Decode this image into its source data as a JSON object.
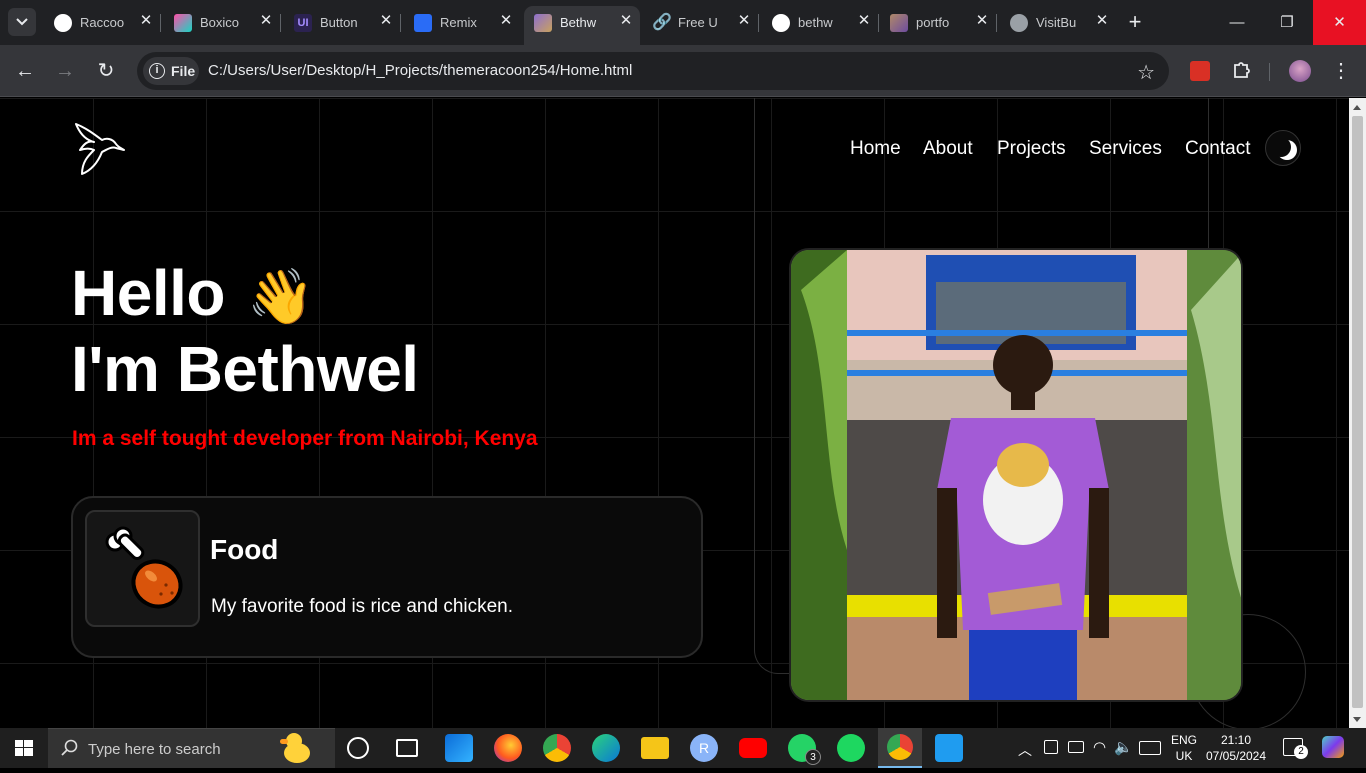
{
  "browser": {
    "tabs": [
      {
        "title": "Raccoo",
        "color": "#ffffff",
        "icon": "github-icon"
      },
      {
        "title": "Boxico",
        "color": "#16d6c3",
        "icon": "boxicons-icon"
      },
      {
        "title": "Button",
        "color": "#6c5ce7",
        "icon": "uiverse-icon"
      },
      {
        "title": "Remix",
        "color": "#2a6cf6",
        "icon": "remix-icon"
      },
      {
        "title": "Bethw",
        "color": "#8e6fd0",
        "icon": "site-icon",
        "active": true
      },
      {
        "title": "Free U",
        "color": "#8ab4f8",
        "icon": "link-icon"
      },
      {
        "title": "bethw",
        "color": "#ffffff",
        "icon": "github-icon"
      },
      {
        "title": "portfo",
        "color": "#b08968",
        "icon": "image-icon"
      },
      {
        "title": "VisitBu",
        "color": "#9aa0a6",
        "icon": "globe-icon"
      }
    ],
    "new_tab": "+",
    "address": {
      "scheme_label": "File",
      "url": "C:/Users/User/Desktop/H_Projects/themeracoon254/Home.html"
    }
  },
  "site": {
    "nav": [
      "Home",
      "About",
      "Projects",
      "Services",
      "Contact"
    ],
    "hero": {
      "greeting": "Hello",
      "wave_emoji": "👋",
      "name_line": "I'm Bethwel",
      "tagline": "Im a self tought developer from Nairobi, Kenya"
    },
    "card": {
      "title": "Food",
      "text": "My favorite food is rice and chicken."
    },
    "accent_color": "#ff0000"
  },
  "taskbar": {
    "search_placeholder": "Type here to search",
    "whatsapp_badge": "3",
    "language": "ENG",
    "region": "UK",
    "time": "21:10",
    "date": "07/05/2024",
    "notifications": "2"
  }
}
